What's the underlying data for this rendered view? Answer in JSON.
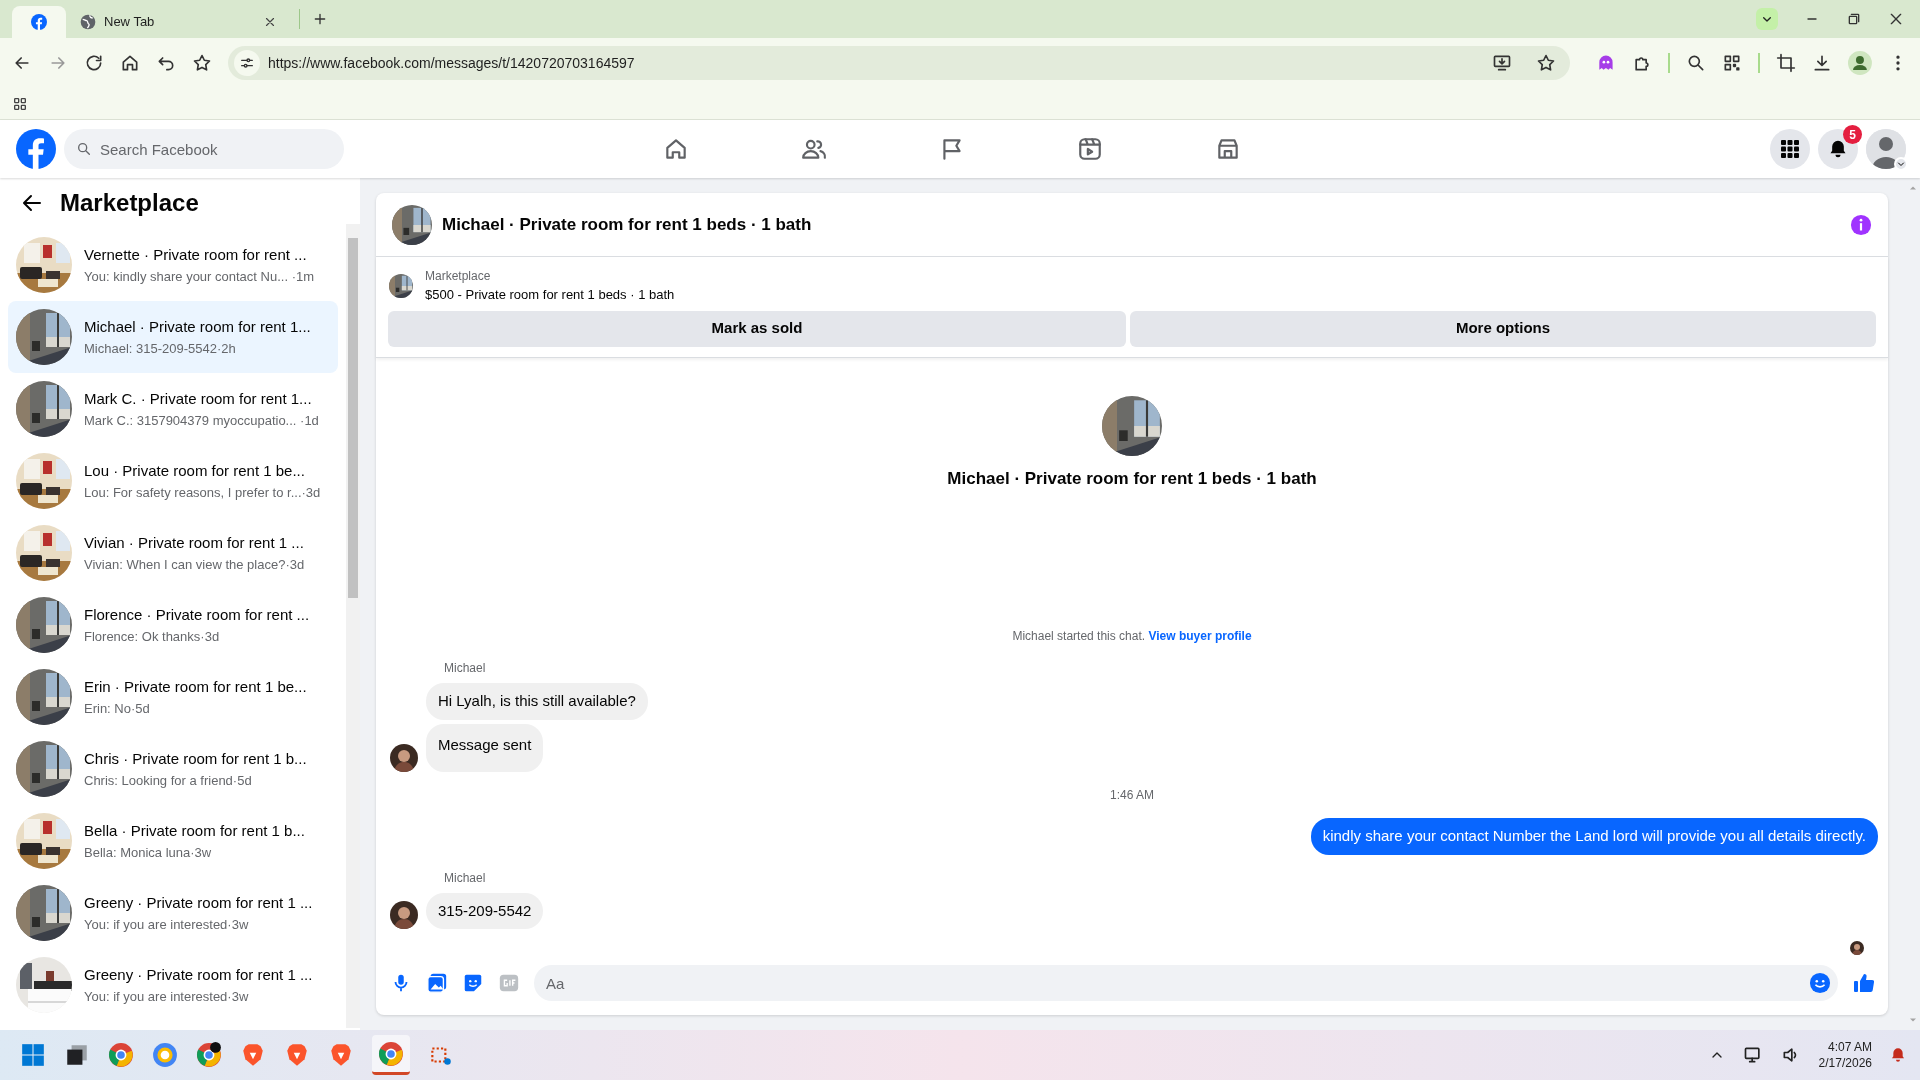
{
  "browser": {
    "tabs": [
      {
        "kind": "facebook",
        "selected": true
      },
      {
        "title": "New Tab",
        "kind": "globe",
        "selected": false
      }
    ],
    "url": "https://www.facebook.com/messages/t/1420720703164597"
  },
  "facebook": {
    "search": {
      "placeholder": "Search Facebook"
    },
    "notifications": "5"
  },
  "sidebar": {
    "title": "Marketplace",
    "conversations": [
      {
        "title": "Vernette · Private room for rent ...",
        "preview": "You: kindly share your contact Nu...",
        "time": " ·1m",
        "selected": false
      },
      {
        "title": "Michael · Private room for rent 1...",
        "preview": "Michael: 315-209-5542",
        "time": "·2h",
        "selected": true
      },
      {
        "title": "Mark C. · Private room for rent 1...",
        "preview": "Mark C.: 3157904379 myoccupatio...",
        "time": " ·1d",
        "selected": false
      },
      {
        "title": "Lou · Private room for rent 1 be...",
        "preview": "Lou: For safety reasons, I prefer to r...",
        "time": "·3d",
        "selected": false
      },
      {
        "title": "Vivian · Private room for rent 1 ...",
        "preview": "Vivian: When I can view the place?",
        "time": "·3d",
        "selected": false
      },
      {
        "title": "Florence · Private room for rent ...",
        "preview": "Florence: Ok thanks",
        "time": "·3d",
        "selected": false
      },
      {
        "title": "Erin · Private room for rent 1 be...",
        "preview": "Erin: No",
        "time": "·5d",
        "selected": false
      },
      {
        "title": "Chris · Private room for rent 1 b...",
        "preview": "Chris: Looking for a friend",
        "time": "·5d",
        "selected": false
      },
      {
        "title": "Bella · Private room for rent 1 b...",
        "preview": "Bella: Monica luna",
        "time": "·3w",
        "selected": false
      },
      {
        "title": "Greeny · Private room for rent 1 ...",
        "preview": "You: if you are interested",
        "time": "·3w",
        "selected": false
      },
      {
        "title": "Greeny · Private room for rent 1 ...",
        "preview": "You: if you are interested",
        "time": "·3w",
        "selected": false
      }
    ]
  },
  "chat": {
    "title": "Michael · Private room for rent 1 beds · 1 bath",
    "listing": {
      "label": "Marketplace",
      "detail": "$500 - Private room for rent 1 beds · 1 bath",
      "buttons": [
        "Mark as sold",
        "More options"
      ]
    },
    "intro_title": "Michael · Private room for rent 1 beds · 1 bath",
    "started": {
      "text": "Michael started this chat.",
      "link": "View buyer profile"
    },
    "messages": [
      {
        "kind": "sender",
        "text": "Michael"
      },
      {
        "kind": "incoming",
        "text": "Hi Lyalh, is this still available?",
        "avatar": false
      },
      {
        "kind": "incoming",
        "text": "Message sent",
        "avatar": true
      },
      {
        "kind": "time",
        "text": "1:46 AM"
      },
      {
        "kind": "outgoing",
        "text": "kindly share your contact Number the Land lord will provide you all details directly."
      },
      {
        "kind": "sender",
        "text": "Michael"
      },
      {
        "kind": "incoming",
        "text": "315-209-5542",
        "avatar": true
      },
      {
        "kind": "read"
      }
    ],
    "composer": {
      "placeholder": "Aa"
    }
  },
  "taskbar": {
    "time": "4:07 AM",
    "date": "2/17/2026"
  }
}
